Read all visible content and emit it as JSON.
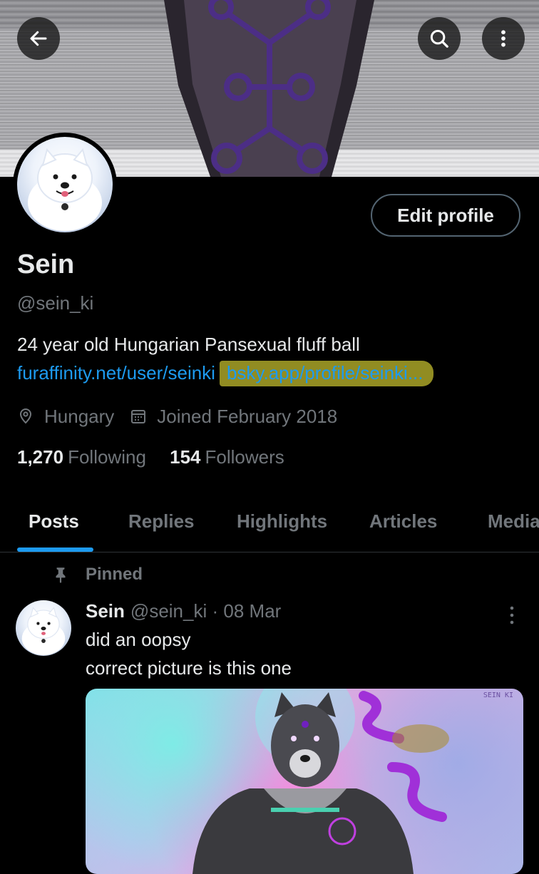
{
  "banner": {
    "icons": {
      "back": "arrow-left-icon",
      "search": "search-icon",
      "more": "more-vertical-icon"
    }
  },
  "profile": {
    "display_name": "Sein",
    "handle": "@sein_ki",
    "edit_button_label": "Edit profile",
    "bio": "24 year old Hungarian Pansexual fluff ball",
    "link_1": "furaffinity.net/user/seinki",
    "link_2": "bsky.app/profile/seinki...",
    "location": "Hungary",
    "joined": "Joined February 2018",
    "following_count": "1,270",
    "following_label": "Following",
    "followers_count": "154",
    "followers_label": "Followers"
  },
  "tabs": [
    {
      "label": "Posts",
      "active": true
    },
    {
      "label": "Replies"
    },
    {
      "label": "Highlights"
    },
    {
      "label": "Articles"
    },
    {
      "label": "Media"
    }
  ],
  "pinned_post": {
    "pinned_label": "Pinned",
    "author_name": "Sein",
    "author_handle": "@sein_ki",
    "separator": "·",
    "date": "08 Mar",
    "text_line_1": "did an oopsy",
    "text_line_2": "correct picture is this one",
    "image_signature": "SEIN KI"
  },
  "colors": {
    "background": "#000000",
    "primary_text": "#e7e9ea",
    "secondary_text": "#71767b",
    "accent_blue": "#1d9bf0",
    "link_highlight": "#aaa528",
    "border": "#2f3336"
  }
}
